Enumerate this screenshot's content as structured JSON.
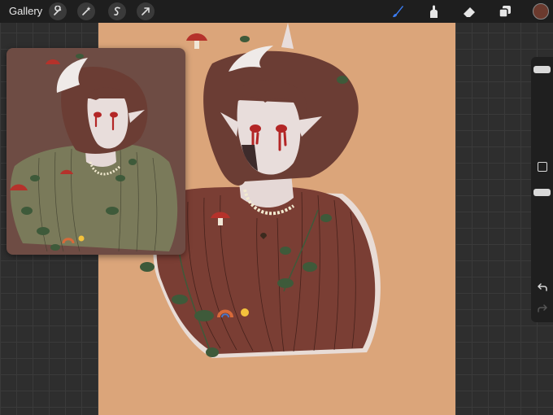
{
  "toolbar": {
    "gallery_label": "Gallery",
    "left_tools": [
      "wrench-icon",
      "magic-wand-icon",
      "selection-icon",
      "transform-arrow-icon"
    ],
    "right_tools": [
      "brush-icon",
      "smudge-icon",
      "eraser-icon",
      "layers-icon"
    ],
    "active_tool": "brush-icon",
    "active_tool_color": "#3b7cf0",
    "current_color": "#6b3a2e"
  },
  "canvas": {
    "background_color": "#dba57a",
    "artwork": "character-illustration"
  },
  "reference": {
    "background_color": "#6e4c44",
    "artwork": "character-illustration-reference"
  },
  "sidebar": {
    "brush_size_level": 0.05,
    "opacity_level": 0.05,
    "tools": [
      "modify-button",
      "undo-icon",
      "redo-icon"
    ]
  }
}
